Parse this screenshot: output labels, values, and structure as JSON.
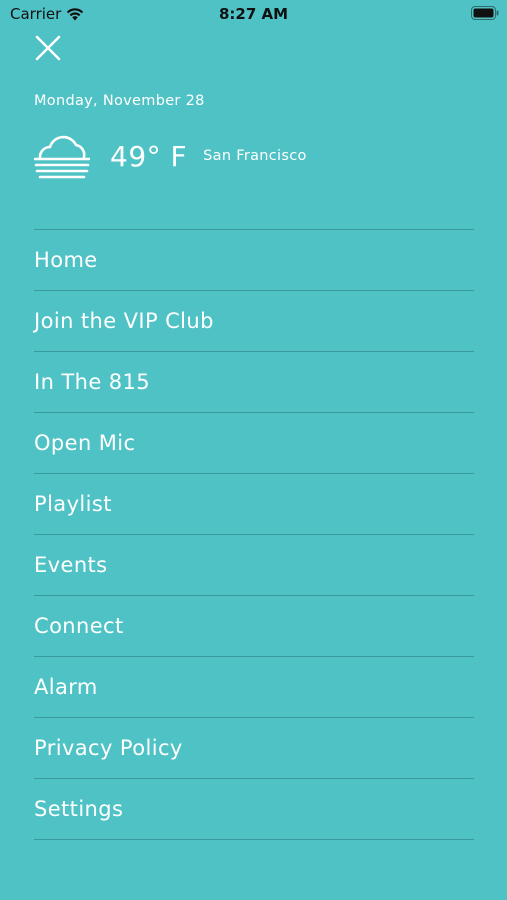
{
  "status_bar": {
    "carrier": "Carrier",
    "time": "8:27 AM",
    "icons": [
      "wifi-icon",
      "battery-icon"
    ]
  },
  "header": {
    "close_icon": "close-icon",
    "date": "Monday, November 28",
    "weather_icon": "fog-cloud-icon",
    "temperature": "49° F",
    "city": "San Francisco"
  },
  "menu": {
    "items": [
      {
        "label": "Home"
      },
      {
        "label": "Join the VIP Club"
      },
      {
        "label": "In The 815"
      },
      {
        "label": "Open Mic"
      },
      {
        "label": "Playlist"
      },
      {
        "label": "Events"
      },
      {
        "label": "Connect"
      },
      {
        "label": "Alarm"
      },
      {
        "label": "Privacy Policy"
      },
      {
        "label": "Settings"
      }
    ]
  },
  "colors": {
    "background": "#4fc2c5",
    "text": "#ffffff",
    "divider": "#28787a"
  }
}
